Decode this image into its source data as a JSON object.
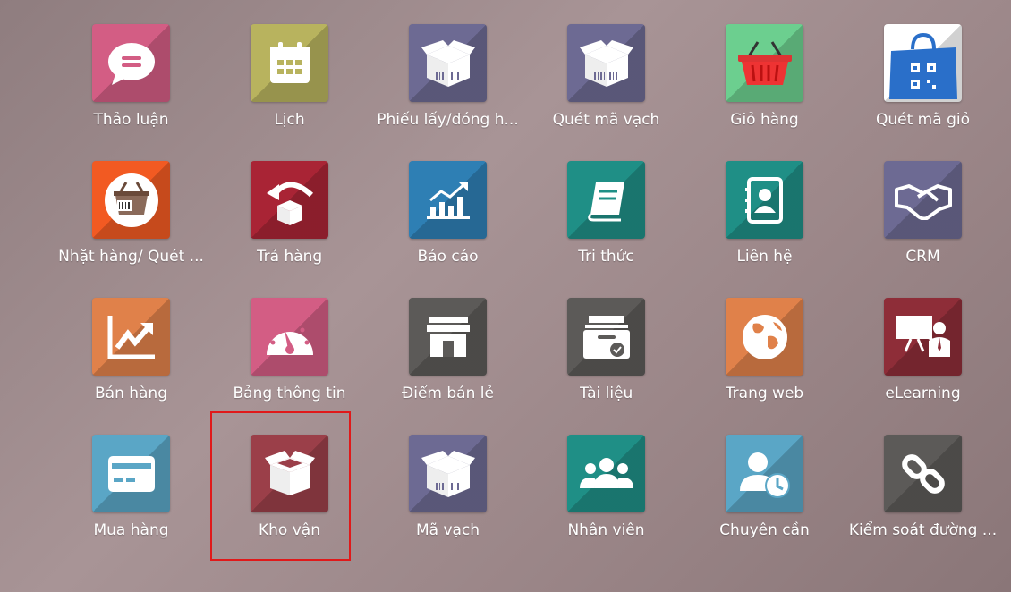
{
  "apps": [
    {
      "label": "Thảo luận",
      "icon": "chat-bubble-icon",
      "color": "#d35d84"
    },
    {
      "label": "Lịch",
      "icon": "calendar-icon",
      "color": "#b8b35e"
    },
    {
      "label": "Phiếu lấy/đóng h...",
      "icon": "box-barcode-icon",
      "color": "#6d6a93"
    },
    {
      "label": "Quét mã vạch",
      "icon": "box-barcode-icon",
      "color": "#6d6a93"
    },
    {
      "label": "Giỏ hàng",
      "icon": "basket-icon",
      "color": "#6ccf8f"
    },
    {
      "label": "Quét mã giỏ",
      "icon": "qr-bag-icon",
      "color": "#ffffff"
    },
    {
      "label": "Nhặt hàng/ Quét ...",
      "icon": "basket-barcode-icon",
      "color": "#f25a22"
    },
    {
      "label": "Trả hàng",
      "icon": "return-box-icon",
      "color": "#a92435"
    },
    {
      "label": "Báo cáo",
      "icon": "bar-chart-icon",
      "color": "#2e7fb4"
    },
    {
      "label": "Tri thức",
      "icon": "book-icon",
      "color": "#1f8f86"
    },
    {
      "label": "Liên hệ",
      "icon": "address-book-icon",
      "color": "#1f8f86"
    },
    {
      "label": "CRM",
      "icon": "handshake-icon",
      "color": "#6d6a93"
    },
    {
      "label": "Bán hàng",
      "icon": "trend-chart-icon",
      "color": "#e0814a"
    },
    {
      "label": "Bảng thông tin",
      "icon": "dashboard-gauge-icon",
      "color": "#d35d84"
    },
    {
      "label": "Điểm bán lẻ",
      "icon": "store-icon",
      "color": "#5c5a58"
    },
    {
      "label": "Tài liệu",
      "icon": "archive-icon",
      "color": "#5c5a58"
    },
    {
      "label": "Trang web",
      "icon": "globe-icon",
      "color": "#e0814a"
    },
    {
      "label": "eLearning",
      "icon": "presentation-icon",
      "color": "#8e2d38"
    },
    {
      "label": "Mua hàng",
      "icon": "credit-card-icon",
      "color": "#5aa6c6"
    },
    {
      "label": "Kho vận",
      "icon": "box-open-icon",
      "color": "#9b3f49"
    },
    {
      "label": "Mã vạch",
      "icon": "box-barcode-icon",
      "color": "#6d6a93"
    },
    {
      "label": "Nhân viên",
      "icon": "users-icon",
      "color": "#1f8f86"
    },
    {
      "label": "Chuyên cần",
      "icon": "user-clock-icon",
      "color": "#5aa6c6"
    },
    {
      "label": "Kiểm soát đường ...",
      "icon": "link-chain-icon",
      "color": "#5c5a58"
    }
  ],
  "highlight_color": "#e0191a"
}
